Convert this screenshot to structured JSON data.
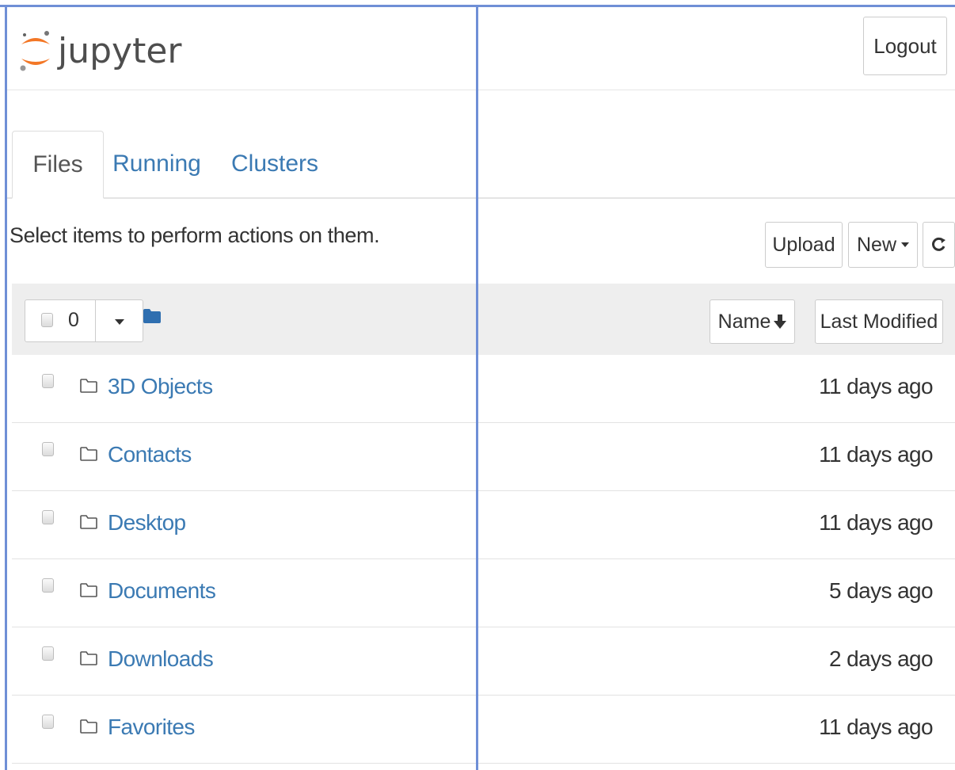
{
  "header": {
    "logo_text": "jupyter",
    "logout_label": "Logout"
  },
  "tabs": [
    {
      "label": "Files",
      "active": true
    },
    {
      "label": "Running",
      "active": false
    },
    {
      "label": "Clusters",
      "active": false
    }
  ],
  "toolbar": {
    "select_message": "Select items to perform actions on them.",
    "upload_label": "Upload",
    "new_label": "New",
    "refresh_icon": "refresh-icon"
  },
  "list_header": {
    "selected_count": "0",
    "sort_name_label": "Name",
    "sort_modified_label": "Last Modified"
  },
  "files": [
    {
      "name": "3D Objects",
      "modified": "11 days ago"
    },
    {
      "name": "Contacts",
      "modified": "11 days ago"
    },
    {
      "name": "Desktop",
      "modified": "11 days ago"
    },
    {
      "name": "Documents",
      "modified": "5 days ago"
    },
    {
      "name": "Downloads",
      "modified": "2 days ago"
    },
    {
      "name": "Favorites",
      "modified": "11 days ago"
    }
  ],
  "colors": {
    "link": "#3b7ab3",
    "logo_orange": "#f37726",
    "annotation_border": "#6f8fd6"
  }
}
